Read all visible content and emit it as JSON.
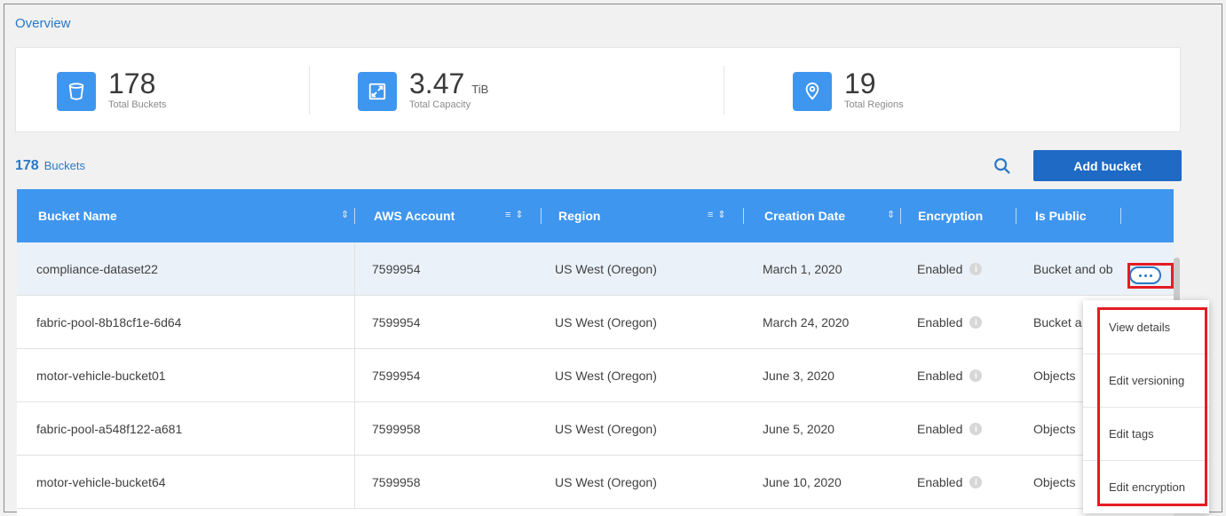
{
  "overview": {
    "title": "Overview",
    "stats": [
      {
        "value": "178",
        "unit": "",
        "label": "Total Buckets",
        "icon": "bucket-icon"
      },
      {
        "value": "3.47",
        "unit": "TiB",
        "label": "Total Capacity",
        "icon": "expand-icon"
      },
      {
        "value": "19",
        "unit": "",
        "label": "Total Regions",
        "icon": "location-pin-icon"
      }
    ]
  },
  "buckets": {
    "count": "178",
    "label": "Buckets",
    "add_button": "Add bucket"
  },
  "table": {
    "columns": [
      "Bucket Name",
      "AWS Account",
      "Region",
      "Creation Date",
      "Encryption",
      "Is Public"
    ],
    "rows": [
      {
        "name": "compliance-dataset22",
        "account": "7599954",
        "region": "US West (Oregon)",
        "date": "March 1, 2020",
        "encryption": "Enabled",
        "public": "Bucket and ob"
      },
      {
        "name": "fabric-pool-8b18cf1e-6d64",
        "account": "7599954",
        "region": "US West (Oregon)",
        "date": "March 24, 2020",
        "encryption": "Enabled",
        "public": "Bucket a"
      },
      {
        "name": "motor-vehicle-bucket01",
        "account": "7599954",
        "region": "US West (Oregon)",
        "date": "June 3, 2020",
        "encryption": "Enabled",
        "public": "Objects"
      },
      {
        "name": "fabric-pool-a548f122-a681",
        "account": "7599958",
        "region": "US West (Oregon)",
        "date": "June 5, 2020",
        "encryption": "Enabled",
        "public": "Objects"
      },
      {
        "name": "motor-vehicle-bucket64",
        "account": "7599958",
        "region": "US West (Oregon)",
        "date": "June 10, 2020",
        "encryption": "Enabled",
        "public": "Objects"
      }
    ]
  },
  "menu": {
    "items": [
      "View details",
      "Edit versioning",
      "Edit tags",
      "Edit encryption"
    ]
  },
  "colors": {
    "accent": "#3f96ef",
    "button": "#1f6ac4",
    "highlight": "#e51c23"
  }
}
